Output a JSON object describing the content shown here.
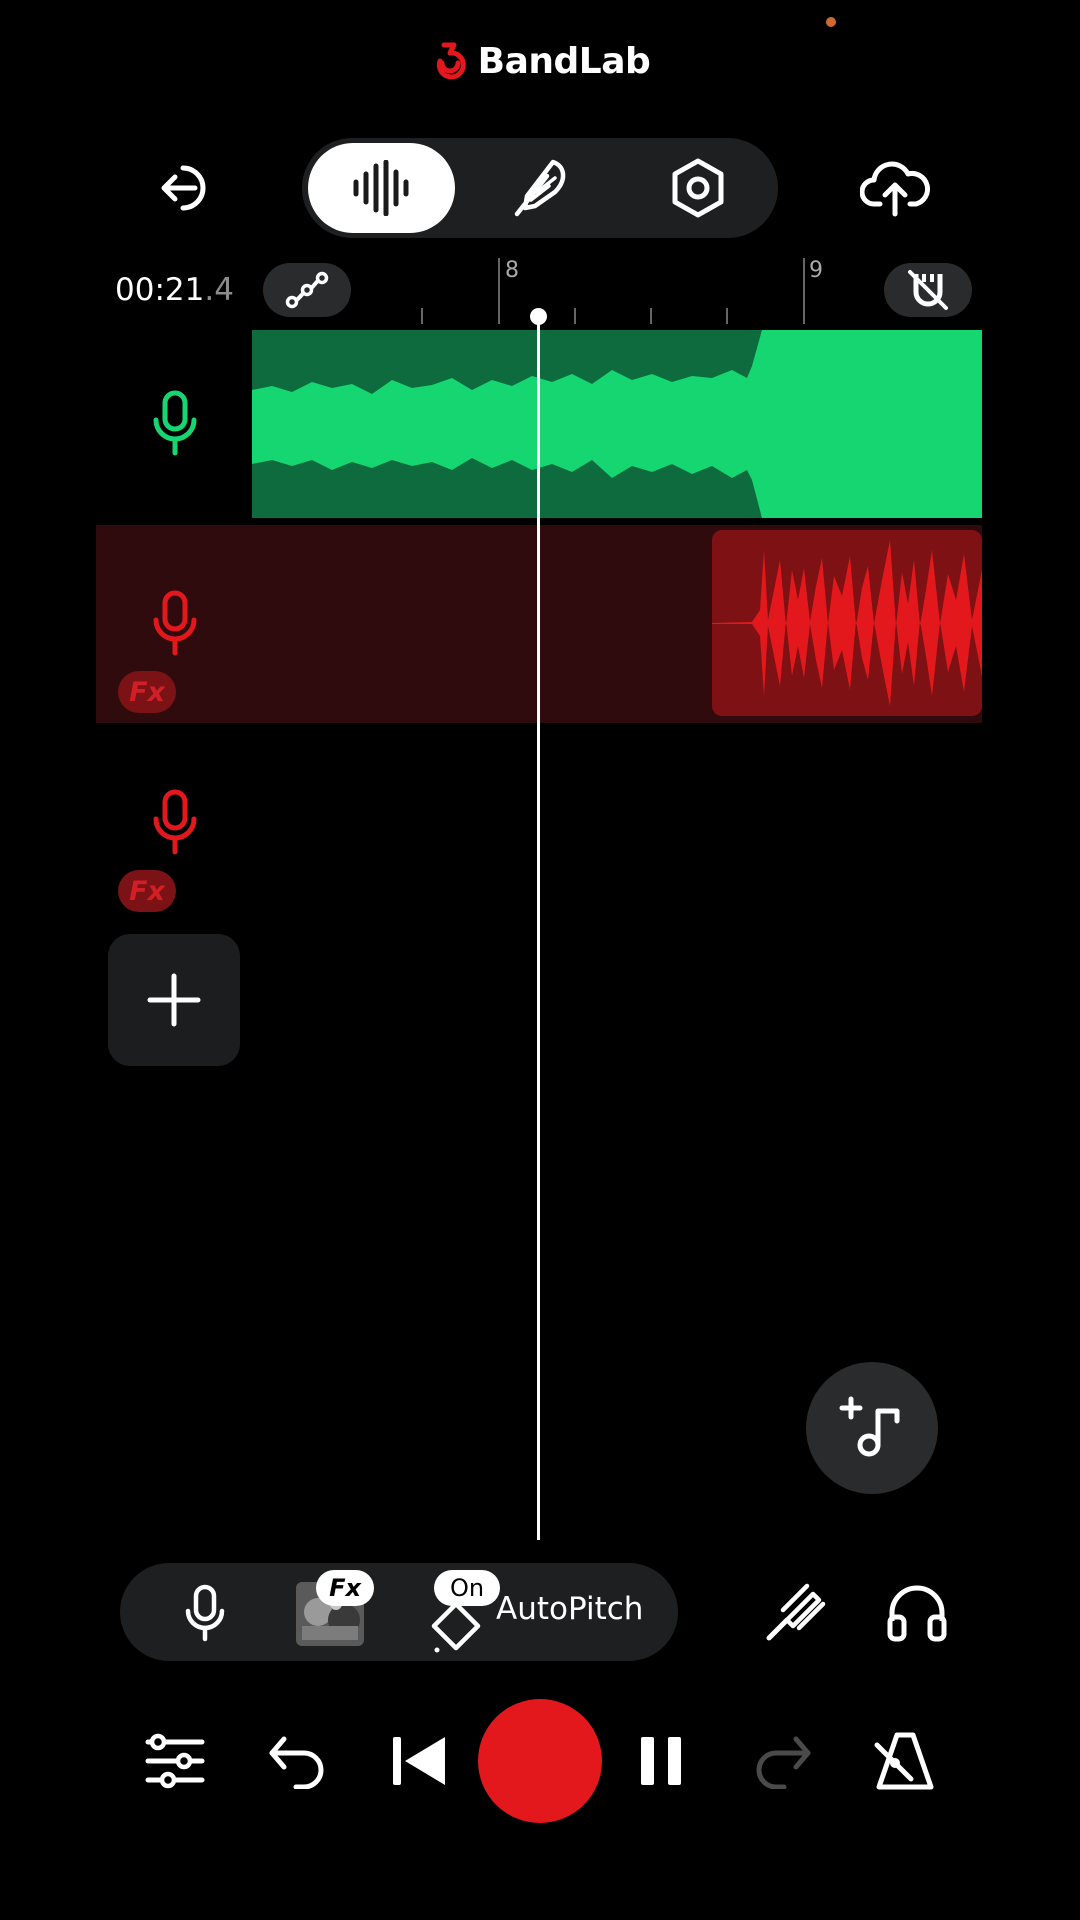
{
  "header": {
    "app_name": "BandLab",
    "brand_color": "#e3181d"
  },
  "top_bar": {
    "back_icon": "exit-icon",
    "modes": [
      "studio-waveform-icon",
      "feather-lyrics-icon",
      "settings-hex-icon"
    ],
    "active_mode": 0,
    "upload_icon": "cloud-upload-icon"
  },
  "timeline": {
    "time_main": "00:21",
    "time_fraction": ".4",
    "automation_icon": "automation-curve-icon",
    "snap_icon": "magnet-off-icon",
    "bar_markers": [
      "8",
      "9"
    ]
  },
  "tracks": [
    {
      "name": "track-1",
      "icon": "microphone-icon",
      "color": "#16d672",
      "has_fx": false,
      "selected": false
    },
    {
      "name": "track-2",
      "icon": "microphone-icon",
      "color": "#e3181d",
      "has_fx": true,
      "fx_label": "Fx",
      "selected": true
    },
    {
      "name": "track-3",
      "icon": "microphone-icon",
      "color": "#e3181d",
      "has_fx": true,
      "fx_label": "Fx",
      "selected": false
    }
  ],
  "add_track_icon": "plus-icon",
  "add_note_icon": "add-music-note-icon",
  "toolbar": {
    "mic_icon": "microphone-icon",
    "fx_badge": "Fx",
    "autopitch_badge": "On",
    "autopitch_label": "AutoPitch",
    "tuner_icon": "tuning-fork-icon",
    "monitor_icon": "headphones-icon"
  },
  "transport": {
    "mixer_icon": "mixer-sliders-icon",
    "undo_icon": "undo-icon",
    "rewind_icon": "skip-to-start-icon",
    "record_icon": "record-button",
    "pause_icon": "pause-icon",
    "redo_icon": "redo-icon",
    "metronome_icon": "metronome-icon"
  }
}
